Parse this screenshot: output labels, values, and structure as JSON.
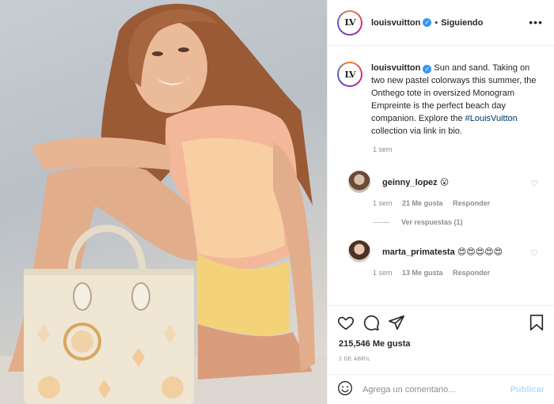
{
  "header": {
    "username": "louisvuitton",
    "follow_label": "Siguiendo",
    "more_label": "•••",
    "avatar_text": "LV"
  },
  "caption": {
    "username": "louisvuitton",
    "text_before": " Sun and sand. Taking on two new pastel colorways this summer, the Onthego tote in oversized Monogram Empreinte is the perfect beach day companion. Explore the ",
    "hashtag": "#LouisVuitton",
    "text_after": " collection via link in bio.",
    "time": "1 sem"
  },
  "comments": [
    {
      "username": "geinny_lopez",
      "text": "😮",
      "time": "1 sem",
      "likes": "21 Me gusta",
      "reply_label": "Responder",
      "view_replies": "Ver respuestas (1)"
    },
    {
      "username": "marta_primatesta",
      "text": "😍😍😍😍😍",
      "time": "1 sem",
      "likes": "13 Me gusta",
      "reply_label": "Responder"
    }
  ],
  "actions": {
    "likes_text": "215,546 Me gusta",
    "date": "1 DE ABRIL"
  },
  "add_comment": {
    "placeholder": "Agrega un comentario...",
    "post_label": "Publicar"
  },
  "colors": {
    "verified": "#3897f0",
    "link": "#00376b",
    "post_button_disabled": "#b2dffc",
    "muted": "#8e8e8e"
  }
}
